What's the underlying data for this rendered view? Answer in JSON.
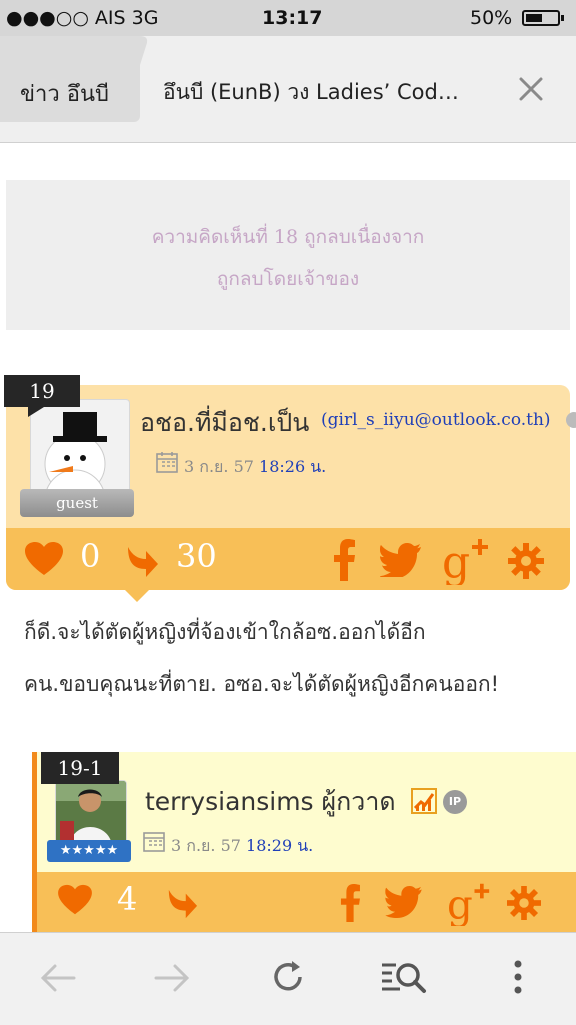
{
  "status_bar": {
    "carrier": "●●●○○ AIS   3G",
    "time": "13:17",
    "battery": "50%",
    "battery_level": 0.5
  },
  "tabs": [
    {
      "label": "ข่าว อึนบี"
    },
    {
      "label": "อึนบี (EunB) วง Ladies’ Cod…"
    }
  ],
  "deleted_notice": {
    "line1": "ความคิดเห็นที่ 18 ถูกลบเนื่องจาก",
    "line2": "ถูกลบโดยเจ้าของ"
  },
  "comment": {
    "number": "19",
    "name": "อชอ.ที่มีอช.เป็น",
    "email": "(girl_s_iiyu@outlook.co.th)",
    "date": "3 ก.ย. 57",
    "time": "18:26 น.",
    "badge": "guest",
    "likes": "0",
    "replies": "30",
    "body_line1": "ก็ดี.จะได้ตัดผู้หญิงที่จ้องเข้าใกล้อซ.ออกได้อีก",
    "body_line2": "คน.ขอบคุณนะที่ตาย. อซอ.จะได้ตัดผู้หญิงอีกคนออก!"
  },
  "reply": {
    "number": "19-1",
    "name": "terrysiansims ผู้กวาด",
    "date": "3 ก.ย. 57",
    "time": "18:29 น.",
    "likes": "4",
    "ip_badge": "IP"
  },
  "colors": {
    "accent": "#f06a00",
    "card_header": "#fde1a8",
    "card_footer": "#f8bf57",
    "reply_bg": "#fefccf"
  }
}
